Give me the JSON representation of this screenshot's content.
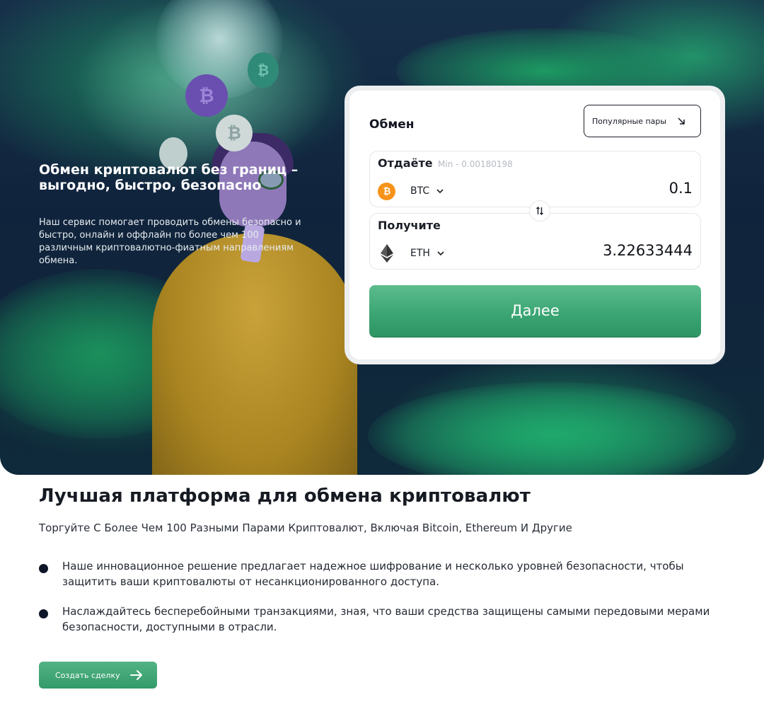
{
  "hero": {
    "title": "Обмен криптовалют без границ – выгодно, быстро, безопасно",
    "description": "Наш сервис помогает проводить обмены безопасно и быстро, онлайн и оффлайн по более чем 100 различным криптовалютно-фиатным направлениям обмена."
  },
  "exchange": {
    "title": "Обмен",
    "popular_pairs_label": "Популярные пары",
    "give": {
      "label": "Отдаёте",
      "min_text": "Min - 0.00180198",
      "coin": "BTC",
      "coin_icon": "bitcoin-icon",
      "amount": "0.1"
    },
    "receive": {
      "label": "Получите",
      "coin": "ETH",
      "coin_icon": "ethereum-icon",
      "amount": "3.22633444"
    },
    "next_label": "Далее"
  },
  "platform": {
    "title": "Лучшая платформа для обмена криптовалют",
    "subtitle": "Торгуйте С Более Чем 100 Разными Парами Криптовалют, Включая Bitcoin, Ethereum И Другие",
    "bullets": [
      "Наше инновационное решение предлагает надежное шифрование и несколько уровней безопасности, чтобы защитить ваши криптовалюты от несанкционированного доступа.",
      "Наслаждайтесь бесперебойными транзакциями, зная, что ваши средства защищены самыми передовыми мерами безопасности, доступными в отрасли."
    ],
    "cta_label": "Создать сделку"
  },
  "colors": {
    "accent": "#3aa472",
    "btc": "#f7931a",
    "hero_bg": "#10233c",
    "dark": "#0d1628"
  }
}
